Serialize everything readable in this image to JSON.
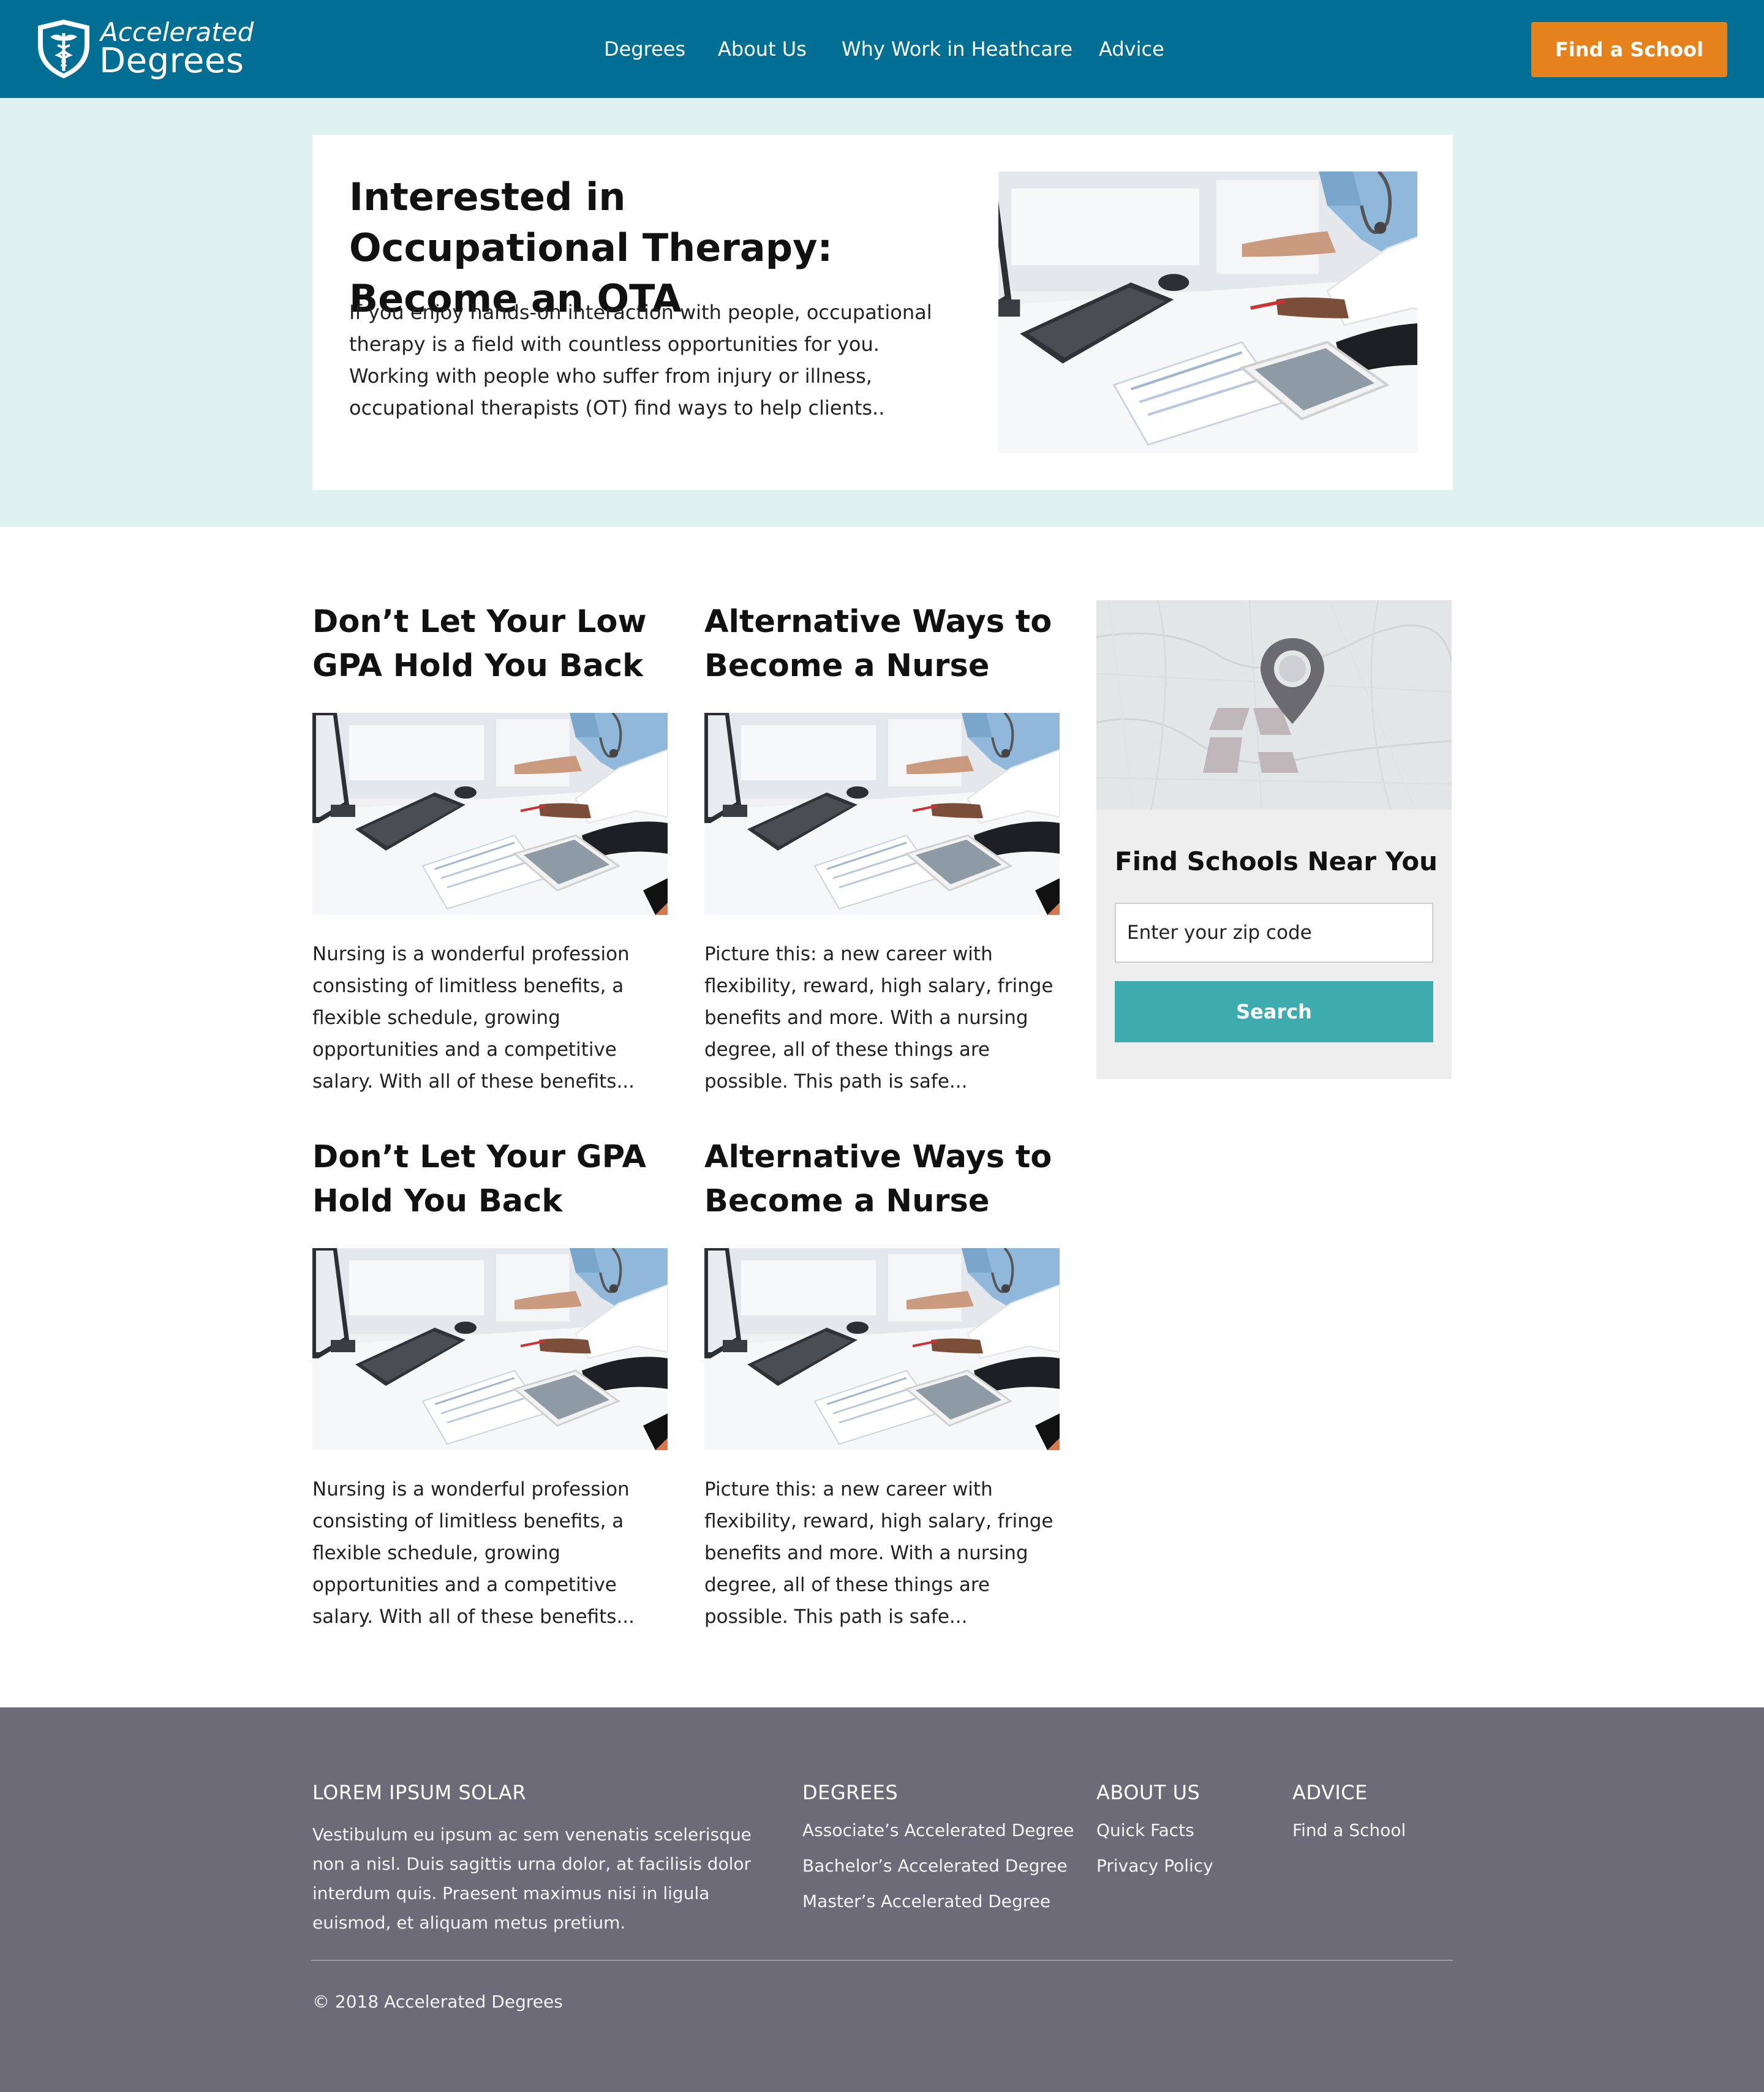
{
  "header": {
    "logo_top": "Accelerated",
    "logo_bottom": "Degrees",
    "nav": [
      "Degrees",
      "About Us",
      "Why Work in Heathcare",
      "Advice"
    ],
    "cta": "Find a School"
  },
  "hero": {
    "title": "Interested in Occupational Therapy: Become an OTA",
    "text": "If you enjoy hands-on interaction with people, occupational therapy is a field with countless opportunities for you. Working with people who suffer from injury or illness, occupational therapists (OT) find ways to help clients.."
  },
  "articles": [
    {
      "title": "Don’t Let Your Low GPA Hold You Back",
      "text": "Nursing is a wonderful profession consisting of limitless benefits, a flexible schedule, growing opportunities and a competitive salary. With all of these benefits..."
    },
    {
      "title": "Alternative Ways to Become a Nurse",
      "text": "Picture this: a new career with flexibility, reward, high salary, fringe benefits and more. With a nursing degree, all of these things are possible. This path is safe..."
    },
    {
      "title": "Don’t Let Your GPA Hold You Back",
      "text": "Nursing is a wonderful profession consisting of limitless benefits, a flexible schedule, growing opportunities and a competitive salary. With all of these benefits..."
    },
    {
      "title": "Alternative Ways to Become a Nurse",
      "text": "Picture this: a new career with flexibility, reward, high salary, fringe benefits and more. With a nursing degree, all of these things are possible. This path is safe..."
    }
  ],
  "finder": {
    "title": "Find Schools Near You",
    "placeholder": "Enter your zip code",
    "button": "Search"
  },
  "footer": {
    "about_heading": "LOREM IPSUM SOLAR",
    "about_text": "Vestibulum eu ipsum ac sem venenatis scelerisque non a nisl. Duis sagittis urna dolor, at facilisis dolor interdum quis. Praesent maximus nisi in ligula euismod, et aliquam metus pretium.",
    "degrees_heading": "DEGREES",
    "degrees_links": [
      "Associate’s Accelerated Degree",
      "Bachelor’s Accelerated Degree",
      "Master’s Accelerated Degree"
    ],
    "about_us_heading": "ABOUT US",
    "about_us_links": [
      "Quick Facts",
      "Privacy Policy"
    ],
    "advice_heading": "ADVICE",
    "advice_links": [
      "Find a School"
    ],
    "copyright": "© 2018 Accelerated Degrees"
  },
  "colors": {
    "header_bg": "#016f94",
    "cta": "#e5821c",
    "hero_band": "#e0f2f0",
    "search_button": "#3eacaf",
    "footer_bg": "#6e6b78"
  },
  "icons": {
    "logo": "caduceus-shield-icon",
    "map_pin": "map-pin-icon"
  }
}
